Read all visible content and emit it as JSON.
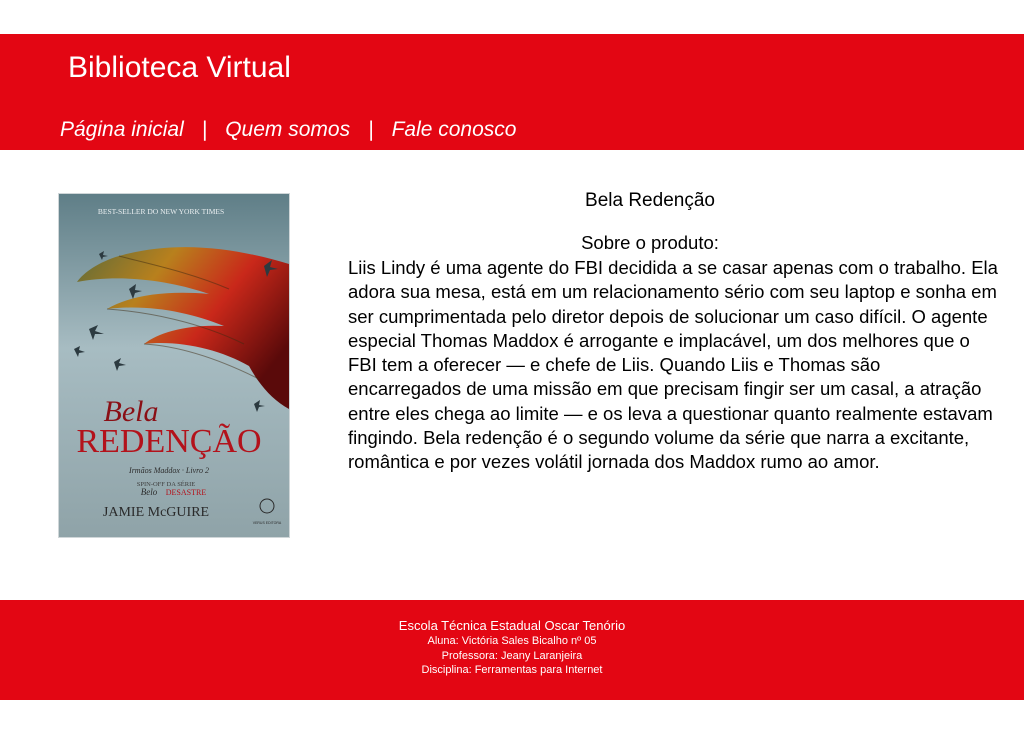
{
  "header": {
    "site_title": "Biblioteca Virtual",
    "nav": {
      "home": "Página inicial",
      "about": "Quem somos",
      "contact": "Fale conosco",
      "separator": "|"
    }
  },
  "product": {
    "title": "Bela Redenção",
    "about_label": "Sobre o produto:",
    "description": "Liis Lindy é uma agente do FBI decidida a se casar apenas com o trabalho. Ela adora sua mesa, está em um relacionamento sério com seu laptop e sonha em ser cumprimentada pelo diretor depois de solucionar um caso difícil. O agente especial Thomas Maddox é arrogante e implacável, um dos melhores que o FBI tem a oferecer — e chefe de Liis. Quando Liis e Thomas são encarregados de uma missão em que precisam fingir ser um casal, a atração entre eles chega ao limite — e os leva a questionar quanto realmente estavam fingindo. Bela redenção é o segundo volume da série que narra a excitante, romântica e por vezes volátil jornada dos Maddox rumo ao amor.",
    "cover": {
      "top_line": "BEST-SELLER DO NEW YORK TIMES",
      "title_script": "Bela",
      "title_main": "REDENÇÃO",
      "series": "Irmãos Maddox · Livro 2",
      "spinoff_line": "SPIN-OFF DA SÉRIE",
      "spinoff_script": "Belo",
      "spinoff_main": "DESASTRE",
      "author": "JAMIE McGUIRE",
      "publisher": "VERUS EDITORA"
    }
  },
  "footer": {
    "school": "Escola Técnica Estadual Oscar Tenório",
    "student": "Aluna: Victória Sales Bicalho   nº 05",
    "teacher": "Professora: Jeany Laranjeira",
    "subject": "Disciplina: Ferramentas para Internet"
  },
  "colors": {
    "brand_red": "#e30613",
    "cover_bg": "#a9bdc4",
    "cover_title_red": "#b3121b"
  }
}
